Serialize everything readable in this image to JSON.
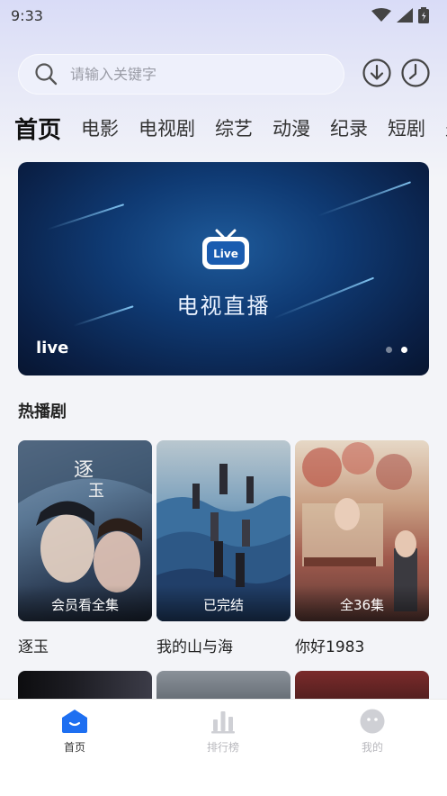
{
  "status_bar": {
    "time": "9:33"
  },
  "search": {
    "placeholder": "请输入关键字"
  },
  "tabs": [
    "首页",
    "电影",
    "电视剧",
    "综艺",
    "动漫",
    "纪录",
    "短剧",
    "少"
  ],
  "banner": {
    "caption": "电视直播",
    "tv_text": "Live",
    "label": "live",
    "page_count": 2,
    "active_index": 1
  },
  "section": {
    "title": "热播剧"
  },
  "dramas": [
    {
      "title": "逐玉",
      "badge": "会员看全集"
    },
    {
      "title": "我的山与海",
      "badge": "已完结"
    },
    {
      "title": "你好1983",
      "badge": "全36集"
    }
  ],
  "nav": {
    "home": "首页",
    "ranking": "排行榜",
    "mine": "我的"
  },
  "colors": {
    "accent": "#1e6ff1",
    "inactive": "#b8b8bd"
  },
  "icons": [
    "search-icon",
    "download-icon",
    "history-icon",
    "wifi-icon",
    "signal-icon",
    "battery-icon",
    "home-icon",
    "ranking-icon",
    "profile-icon"
  ]
}
